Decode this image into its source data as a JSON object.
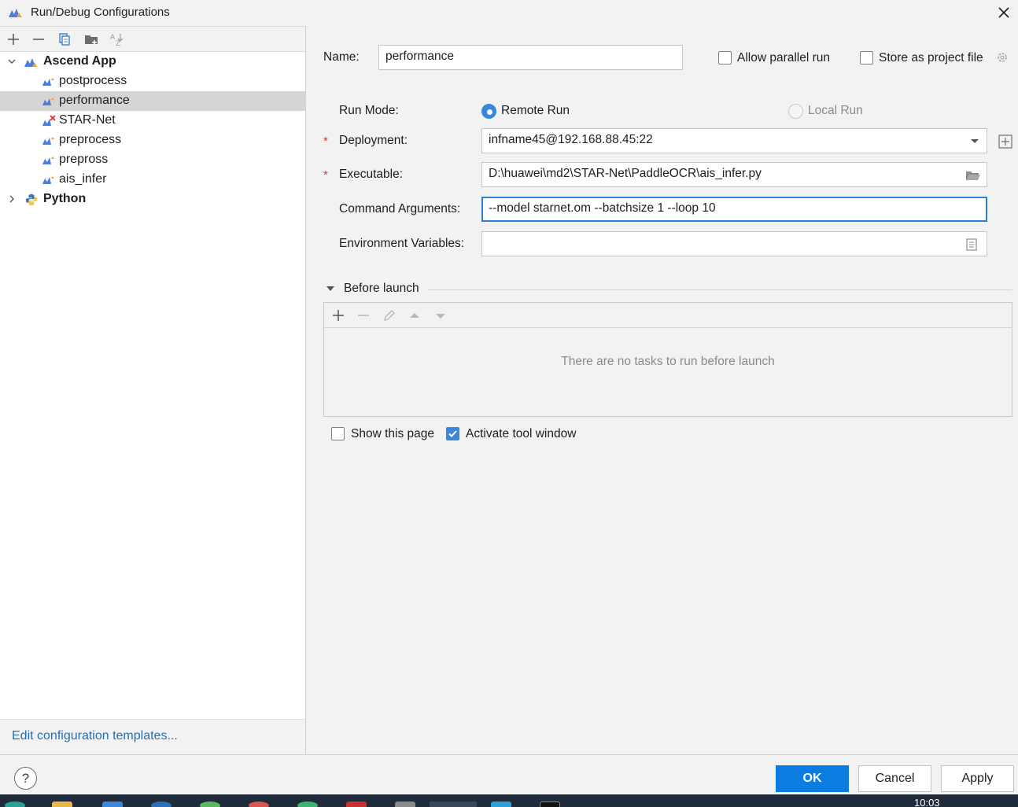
{
  "window": {
    "title": "Run/Debug Configurations"
  },
  "tree": {
    "groups": [
      {
        "label": "Ascend App",
        "children": [
          "postprocess",
          "performance",
          "STAR-Net",
          "preprocess",
          "prepross",
          "ais_infer"
        ]
      },
      {
        "label": "Python"
      }
    ],
    "selected": "performance"
  },
  "left_footer": {
    "edit_templates": "Edit configuration templates..."
  },
  "form": {
    "name_label": "Name:",
    "name_value": "performance",
    "allow_parallel": "Allow parallel run",
    "store_project": "Store as project file",
    "run_mode_label": "Run Mode:",
    "remote_run": "Remote Run",
    "local_run": "Local Run",
    "required_mark": "*",
    "deployment_label": "Deployment:",
    "deployment_value": "infname45@192.168.88.45:22",
    "executable_label": "Executable:",
    "executable_value": "D:\\huawei\\md2\\STAR-Net\\PaddleOCR\\ais_infer.py",
    "args_label": "Command Arguments:",
    "args_value": "--model starnet.om --batchsize 1 --loop 10",
    "env_label": "Environment Variables:",
    "env_value": ""
  },
  "before_launch": {
    "title": "Before launch",
    "empty": "There are no tasks to run before launch",
    "show_page": "Show this page",
    "activate_tool": "Activate tool window"
  },
  "buttons": {
    "help": "?",
    "ok": "OK",
    "cancel": "Cancel",
    "apply": "Apply"
  },
  "taskbar": {
    "clock": "10:03"
  },
  "colors": {
    "accent": "#0b7ce0",
    "link": "#2470b3",
    "required": "#d93030",
    "selection": "#d5d5d5"
  }
}
